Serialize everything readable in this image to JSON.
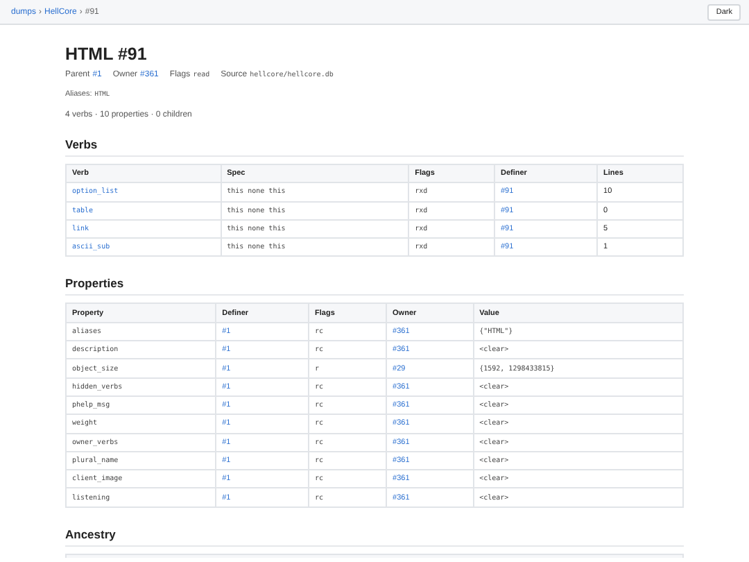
{
  "breadcrumb": {
    "separator": "›",
    "items": [
      {
        "label": "dumps",
        "kind": "link"
      },
      {
        "label": "HellCore",
        "kind": "link"
      },
      {
        "label": "#91",
        "kind": "current"
      }
    ]
  },
  "theme_button": "Dark",
  "title": "HTML #91",
  "meta": [
    {
      "label": "Parent",
      "value": "#1",
      "kind": "link"
    },
    {
      "label": "Owner",
      "value": "#361",
      "kind": "link"
    },
    {
      "label": "Flags",
      "value": "read",
      "kind": "mono"
    },
    {
      "label": "Source",
      "value": "hellcore/hellcore.db",
      "kind": "mono"
    }
  ],
  "aliases": {
    "label": "Aliases:",
    "value": "HTML"
  },
  "summary": "4 verbs · 10 properties · 0 children",
  "sections": [
    {
      "heading": "Verbs",
      "columns": [
        {
          "label": "Verb",
          "kind": "mono-link"
        },
        {
          "label": "Spec",
          "kind": "mono"
        },
        {
          "label": "Flags",
          "kind": "mono"
        },
        {
          "label": "Definer",
          "kind": "link"
        },
        {
          "label": "Lines",
          "kind": "text"
        }
      ],
      "rows": [
        [
          "option_list",
          "this none this",
          "rxd",
          "#91",
          "10"
        ],
        [
          "table",
          "this none this",
          "rxd",
          "#91",
          "0"
        ],
        [
          "link",
          "this none this",
          "rxd",
          "#91",
          "5"
        ],
        [
          "ascii_sub",
          "this none this",
          "rxd",
          "#91",
          "1"
        ]
      ]
    },
    {
      "heading": "Properties",
      "columns": [
        {
          "label": "Property",
          "kind": "mono"
        },
        {
          "label": "Definer",
          "kind": "link"
        },
        {
          "label": "Flags",
          "kind": "mono"
        },
        {
          "label": "Owner",
          "kind": "link"
        },
        {
          "label": "Value",
          "kind": "mono"
        }
      ],
      "rows": [
        [
          "aliases",
          "#1",
          "rc",
          "#361",
          "{\"HTML\"}"
        ],
        [
          "description",
          "#1",
          "rc",
          "#361",
          "<clear>"
        ],
        [
          "object_size",
          "#1",
          "r",
          "#29",
          "{1592, 1298433815}"
        ],
        [
          "hidden_verbs",
          "#1",
          "rc",
          "#361",
          "<clear>"
        ],
        [
          "phelp_msg",
          "#1",
          "rc",
          "#361",
          "<clear>"
        ],
        [
          "weight",
          "#1",
          "rc",
          "#361",
          "<clear>"
        ],
        [
          "owner_verbs",
          "#1",
          "rc",
          "#361",
          "<clear>"
        ],
        [
          "plural_name",
          "#1",
          "rc",
          "#361",
          "<clear>"
        ],
        [
          "client_image",
          "#1",
          "rc",
          "#361",
          "<clear>"
        ],
        [
          "listening",
          "#1",
          "rc",
          "#361",
          "<clear>"
        ]
      ]
    },
    {
      "heading": "Ancestry"
    }
  ]
}
